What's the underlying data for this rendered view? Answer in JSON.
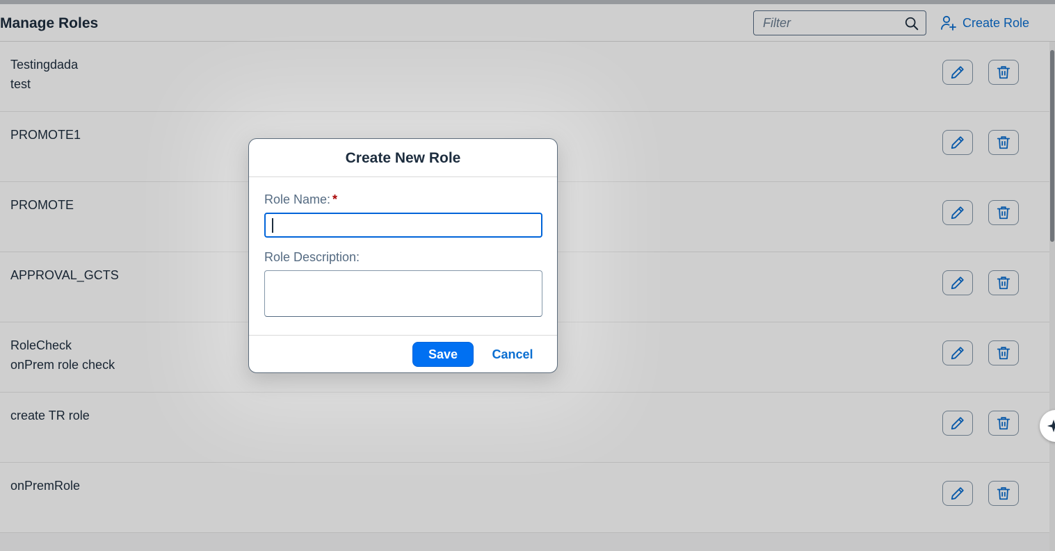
{
  "header": {
    "title": "Manage Roles",
    "filter_placeholder": "Filter",
    "create_role_label": "Create Role"
  },
  "roles": [
    {
      "name": "Testingdada",
      "description": "test"
    },
    {
      "name": "PROMOTE1",
      "description": ""
    },
    {
      "name": "PROMOTE",
      "description": ""
    },
    {
      "name": "APPROVAL_GCTS",
      "description": ""
    },
    {
      "name": "RoleCheck",
      "description": "onPrem role check"
    },
    {
      "name": "create TR role",
      "description": ""
    },
    {
      "name": "onPremRole",
      "description": ""
    }
  ],
  "dialog": {
    "title": "Create New Role",
    "role_name_label": "Role Name:",
    "required_marker": "*",
    "role_name_value": "",
    "role_description_label": "Role Description:",
    "role_description_value": "",
    "save_label": "Save",
    "cancel_label": "Cancel"
  },
  "colors": {
    "accent": "#0a6ed1",
    "primary_button": "#0070f2",
    "required": "#aa0808",
    "text": "#1d2d3e"
  }
}
